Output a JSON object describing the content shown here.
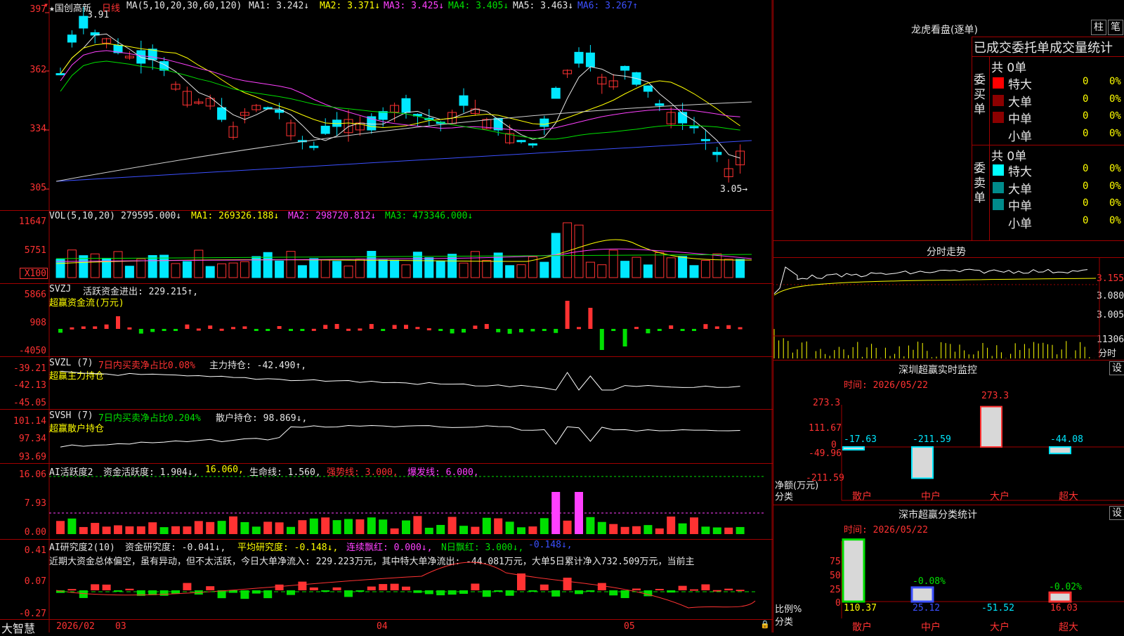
{
  "main": {
    "header": {
      "stock": "★国创高新",
      "period": "日线",
      "ma": "MA(5,10,20,30,60,120)",
      "ma1": "MA1: 3.242↓",
      "ma2": "MA2: 3.371↓",
      "ma3": "MA3: 3.425↓",
      "ma4": "MA4: 3.405↓",
      "ma5": "MA5: 3.463↓",
      "ma6": "MA6: 3.267↑"
    },
    "y_labels": [
      "397",
      "362",
      "334",
      "305"
    ],
    "high_mark": "3.91",
    "low_mark": "3.05→"
  },
  "vol": {
    "header": "VOL(5,10,20)",
    "value": "279595.000↓",
    "ma1": "MA1: 269326.188↓",
    "ma2": "MA2: 298720.812↓",
    "ma3": "MA3: 473346.000↓",
    "y_labels": [
      "11647",
      "5751",
      "X100"
    ]
  },
  "svzj": {
    "header": "SVZJ",
    "line": "活跃资金进出: 229.215↑,",
    "title": "超赢资金流(万元)",
    "y_labels": [
      "5866",
      "908",
      "-4050"
    ]
  },
  "svzl": {
    "header": "SVZL (7)",
    "net": "7日内买卖净占比0.08%",
    "hold": "主力持仓: -42.490↑,",
    "title": "超赢主力持仓",
    "y_labels": [
      "-39.21",
      "-42.13",
      "-45.05"
    ]
  },
  "svsh": {
    "header": "SVSH (7)",
    "net": "7日内买卖净占比0.204%",
    "hold": "散户持仓: 98.869↓,",
    "title": "超赢散户持仓",
    "y_labels": [
      "101.14",
      "97.34",
      "93.69"
    ]
  },
  "ai1": {
    "header": "AI活跃度2",
    "a": "资金活跃度: 1.904↓,",
    "b": "16.060,",
    "c": "生命线: 1.560,",
    "d": "强势线: 3.000,",
    "e": "爆发线: 6.000,",
    "y_labels": [
      "16.06",
      "7.93",
      "0.00"
    ]
  },
  "ai2": {
    "header": "AI研究度2(10)",
    "a": "资金研究度: -0.041↓,",
    "b": "平均研究度: -0.148↓,",
    "c": "连续飘红: 0.000↓,",
    "d": "N日飘红: 3.000↓,",
    "e": "-0.148↓,",
    "summary": "近期大资金总体偏空，虽有异动，但不太活跃，今日大单净流入: 229.223万元，其中特大单净流出: -44.081万元，大单5日累计净入732.509万元，当前主",
    "y_labels": [
      "0.41",
      "0.07",
      "-0.27"
    ]
  },
  "bottom": {
    "brand": "大智慧",
    "dates": [
      "2026/02",
      "03",
      "04",
      "05"
    ]
  },
  "right": {
    "title": "龙虎看盘(逐单)",
    "btn1": "柱",
    "btn2": "笔",
    "subtitle": "已成交委托单成交量统计",
    "buy": {
      "label": "委买单",
      "total": "共 0单",
      "rows": [
        {
          "name": "特大",
          "v": "0",
          "p": "0%"
        },
        {
          "name": "大单",
          "v": "0",
          "p": "0%"
        },
        {
          "name": "中单",
          "v": "0",
          "p": "0%"
        },
        {
          "name": "小单",
          "v": "0",
          "p": "0%"
        }
      ]
    },
    "sell": {
      "label": "委卖单",
      "total": "共 0单",
      "rows": [
        {
          "name": "特大",
          "v": "0",
          "p": "0%"
        },
        {
          "name": "大单",
          "v": "0",
          "p": "0%"
        },
        {
          "name": "中单",
          "v": "0",
          "p": "0%"
        },
        {
          "name": "小单",
          "v": "0",
          "p": "0%"
        }
      ]
    },
    "fenshi": {
      "title": "分时走势",
      "y_labels": [
        "3.155",
        "3.080",
        "3.005",
        "11306",
        "分时"
      ]
    },
    "sz_monitor": {
      "title": "深圳超赢实时监控",
      "btn": "设",
      "time": "时间: 2026/05/22",
      "y_labels": [
        "273.3",
        "111.67",
        "0",
        "-49.96",
        "-211.59"
      ],
      "values": [
        -17.63,
        -211.59,
        273.3,
        -44.08
      ],
      "value_labels": [
        "-17.63",
        "-211.59",
        "273.3",
        "-44.08"
      ],
      "unit": "净额(万元)",
      "cat_label": "分类",
      "cats": [
        "散户",
        "中户",
        "大户",
        "超大"
      ]
    },
    "sz_class": {
      "title": "深市超赢分类统计",
      "btn": "设",
      "time": "时间: 2026/05/22",
      "y_labels": [
        "75",
        "50",
        "25",
        "0"
      ],
      "pct_labels": [
        "-0.08%",
        "-0.02%"
      ],
      "values": [
        110.37,
        25.12,
        -51.52,
        16.03
      ],
      "value_labels": [
        "110.37",
        "25.12",
        "-51.52",
        "16.03"
      ],
      "unit": "比例%",
      "cat_label": "分类",
      "cats": [
        "散户",
        "中户",
        "大户",
        "超大"
      ]
    }
  }
}
